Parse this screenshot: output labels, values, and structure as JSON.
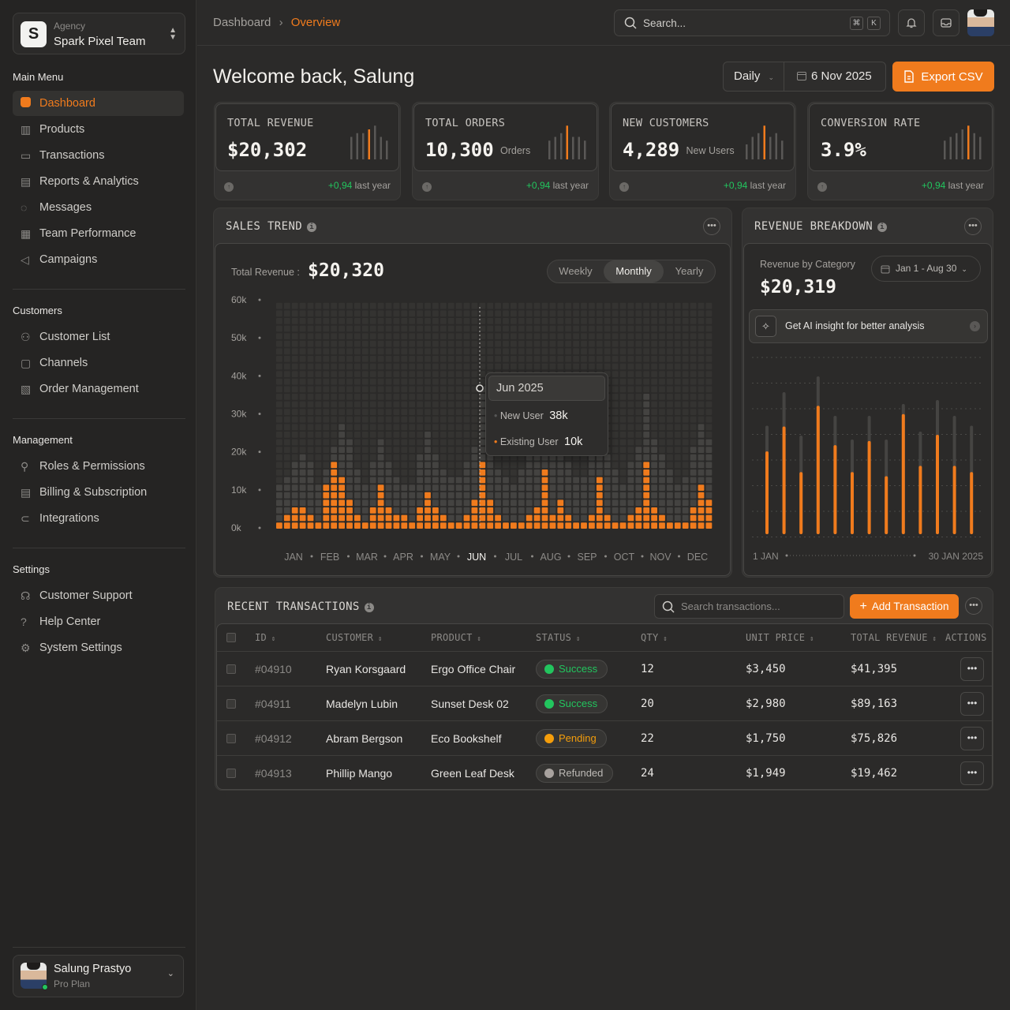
{
  "sidebar": {
    "team": {
      "sub": "Agency",
      "name": "Spark Pixel Team",
      "logo": "S"
    },
    "sections": [
      {
        "title": "Main Menu",
        "items": [
          {
            "label": "Dashboard",
            "icon": "home-icon",
            "active": true
          },
          {
            "label": "Products",
            "icon": "shop-icon"
          },
          {
            "label": "Transactions",
            "icon": "wallet-icon"
          },
          {
            "label": "Reports & Analytics",
            "icon": "document-icon"
          },
          {
            "label": "Messages",
            "icon": "chat-icon"
          },
          {
            "label": "Team Performance",
            "icon": "chart-icon"
          },
          {
            "label": "Campaigns",
            "icon": "megaphone-icon"
          }
        ]
      },
      {
        "title": "Customers",
        "items": [
          {
            "label": "Customer List",
            "icon": "users-icon"
          },
          {
            "label": "Channels",
            "icon": "monitor-icon"
          },
          {
            "label": "Order Management",
            "icon": "receipt-icon"
          }
        ]
      },
      {
        "title": "Management",
        "items": [
          {
            "label": "Roles & Permissions",
            "icon": "user-key-icon"
          },
          {
            "label": "Billing & Subscription",
            "icon": "billing-icon"
          },
          {
            "label": "Integrations",
            "icon": "plug-icon"
          }
        ]
      },
      {
        "title": "Settings",
        "items": [
          {
            "label": "Customer Support",
            "icon": "headset-icon"
          },
          {
            "label": "Help Center",
            "icon": "help-icon"
          },
          {
            "label": "System Settings",
            "icon": "gear-icon"
          }
        ]
      }
    ],
    "user": {
      "name": "Salung Prastyo",
      "plan": "Pro Plan"
    }
  },
  "header": {
    "breadcrumb": [
      "Dashboard",
      "Overview"
    ],
    "search_placeholder": "Search...",
    "kbd": [
      "⌘",
      "K"
    ]
  },
  "main": {
    "welcome": "Welcome back, Salung",
    "range": "Daily",
    "date": "6 Nov 2025",
    "export_label": "Export CSV",
    "stats": [
      {
        "title": "TOTAL REVENUE",
        "value": "$20,302",
        "unit": "",
        "delta": "+0,94",
        "delta_label": "last year"
      },
      {
        "title": "TOTAL ORDERS",
        "value": "10,300",
        "unit": "Orders",
        "delta": "+0,94",
        "delta_label": "last year"
      },
      {
        "title": "NEW CUSTOMERS",
        "value": "4,289",
        "unit": "New Users",
        "delta": "+0,94",
        "delta_label": "last year"
      },
      {
        "title": "CONVERSION RATE",
        "value": "3.9%",
        "unit": "",
        "delta": "+0,94",
        "delta_label": "last year"
      }
    ],
    "sales_trend": {
      "title": "SALES TREND",
      "total_label": "Total Revenue :",
      "total_value": "$20,320",
      "tabs": [
        "Weekly",
        "Monthly",
        "Yearly"
      ],
      "active_tab": "Monthly",
      "tooltip": {
        "title": "Jun 2025",
        "rows": [
          {
            "label": "New User",
            "value": "38k"
          },
          {
            "label": "Existing User",
            "value": "10k"
          }
        ]
      }
    },
    "revenue_breakdown": {
      "title": "REVENUE BREAKDOWN",
      "subtitle": "Revenue by Category",
      "value": "$20,319",
      "date_range": "Jan 1 - Aug 30",
      "ai_label": "Get AI insight for better analysis",
      "x_start": "1 JAN",
      "x_end": "30 JAN 2025"
    },
    "transactions": {
      "title": "RECENT TRANSACTIONS",
      "search_placeholder": "Search transactions...",
      "add_label": "Add Transaction",
      "columns": [
        "ID",
        "CUSTOMER",
        "PRODUCT",
        "STATUS",
        "QTY",
        "UNIT PRICE",
        "TOTAL REVENUE",
        "ACTIONS"
      ],
      "rows": [
        {
          "id": "#04910",
          "customer": "Ryan Korsgaard",
          "product": "Ergo Office Chair",
          "status": "Success",
          "qty": "12",
          "unit": "$3,450",
          "total": "$41,395"
        },
        {
          "id": "#04911",
          "customer": "Madelyn Lubin",
          "product": "Sunset Desk 02",
          "status": "Success",
          "qty": "20",
          "unit": "$2,980",
          "total": "$89,163"
        },
        {
          "id": "#04912",
          "customer": "Abram Bergson",
          "product": "Eco Bookshelf",
          "status": "Pending",
          "qty": "22",
          "unit": "$1,750",
          "total": "$75,826"
        },
        {
          "id": "#04913",
          "customer": "Phillip Mango",
          "product": "Green Leaf Desk",
          "status": "Refunded",
          "qty": "24",
          "unit": "$1,949",
          "total": "$19,462"
        }
      ]
    }
  },
  "colors": {
    "accent": "#f07b1d",
    "success": "#22c55e",
    "pending": "#f59e0b",
    "refunded": "#a8a29e"
  },
  "chart_data": [
    {
      "type": "bar",
      "title": "SALES TREND",
      "y_ticks": [
        "60k",
        "50k",
        "40k",
        "30k",
        "20k",
        "10k",
        "0k"
      ],
      "ylim": [
        0,
        60000
      ],
      "categories": [
        "JAN",
        "FEB",
        "MAR",
        "APR",
        "MAY",
        "JUN",
        "JUL",
        "AUG",
        "SEP",
        "OCT",
        "NOV",
        "DEC"
      ],
      "highlight": "JUN",
      "series": [
        {
          "name": "Existing User",
          "values": [
            0.5,
            1.5,
            3,
            3,
            1.5,
            0.5,
            5,
            8,
            6,
            4,
            1.5,
            0.5,
            3,
            5,
            3,
            2,
            1.5,
            0.5,
            3,
            4.5,
            3,
            1.5,
            1,
            1,
            2,
            4,
            8,
            4,
            1.5,
            1,
            0.5,
            1,
            2,
            3,
            7,
            2,
            4,
            2,
            1,
            1,
            2,
            6,
            2,
            1,
            0.5,
            1.5,
            3,
            8,
            3,
            2,
            1,
            0.5,
            1,
            3,
            5,
            4,
            1.5,
            1,
            1,
            2,
            7,
            5,
            3,
            2,
            1,
            0.5,
            1.5,
            3,
            5,
            3,
            2,
            1,
            0.5,
            1,
            2,
            4,
            6,
            3,
            1
          ]
        },
        {
          "name": "Total",
          "values": [
            12,
            14,
            18,
            20,
            18,
            12,
            16,
            22,
            28,
            24,
            16,
            12,
            18,
            24,
            18,
            14,
            12,
            12,
            20,
            26,
            20,
            16,
            14,
            14,
            18,
            22,
            38,
            24,
            16,
            14,
            12,
            16,
            20,
            26,
            38,
            20,
            24,
            18,
            14,
            14,
            20,
            30,
            20,
            16,
            12,
            18,
            22,
            36,
            24,
            20,
            16,
            12,
            14,
            22,
            28,
            24,
            18,
            14,
            14,
            18,
            30,
            26,
            22,
            18,
            14,
            12,
            16,
            22,
            28,
            22,
            18,
            14,
            12,
            14,
            18,
            24,
            30,
            22,
            14
          ]
        }
      ]
    },
    {
      "type": "bar",
      "title": "REVENUE BREAKDOWN",
      "x_labels": [
        "1 JAN",
        "30 JAN 2025"
      ],
      "series": [
        {
          "name": "Revenue",
          "values": [
            40,
            52,
            30,
            62,
            43,
            30,
            45,
            28,
            58,
            33,
            48,
            33,
            30
          ]
        },
        {
          "name": "Background",
          "values": [
            55,
            72,
            50,
            80,
            60,
            48,
            60,
            48,
            66,
            52,
            68,
            60,
            55
          ]
        }
      ]
    },
    {
      "type": "bar",
      "title": "stat-sparklines",
      "series": [
        {
          "name": "TOTAL REVENUE",
          "values": [
            30,
            35,
            35,
            40,
            45,
            30,
            25
          ],
          "highlight": 3
        },
        {
          "name": "TOTAL ORDERS",
          "values": [
            25,
            30,
            35,
            45,
            30,
            30,
            25
          ],
          "highlight": 3
        },
        {
          "name": "NEW CUSTOMERS",
          "values": [
            20,
            30,
            35,
            45,
            30,
            35,
            25
          ],
          "highlight": 3
        },
        {
          "name": "CONVERSION RATE",
          "values": [
            25,
            30,
            35,
            40,
            45,
            35,
            30
          ],
          "highlight": 4
        }
      ]
    }
  ]
}
